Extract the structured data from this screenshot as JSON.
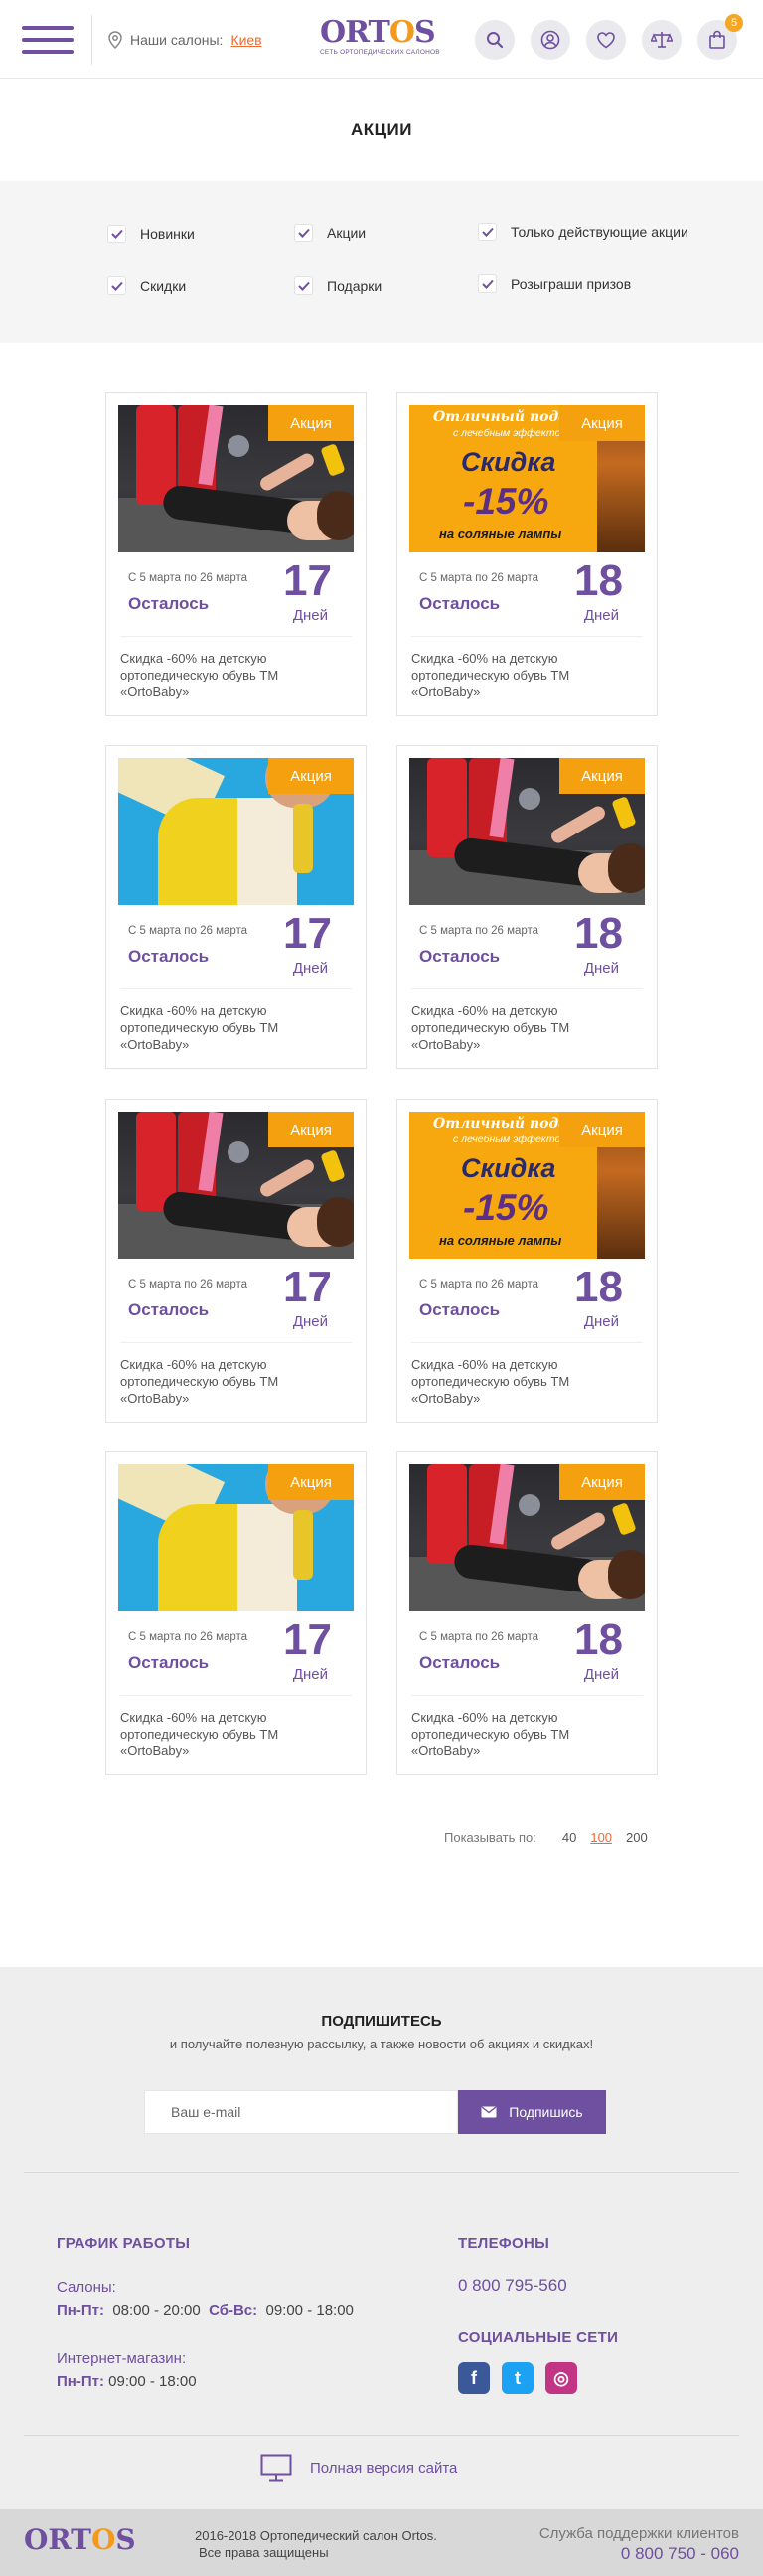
{
  "header": {
    "salons_label": "Наши салоны:",
    "city": "Киев",
    "logo_word_a": "ORT",
    "logo_word_b": "O",
    "logo_word_c": "S",
    "logo_sub": "СЕТЬ ОРТОПЕДИЧЕСКИХ САЛОНОВ",
    "cart_count": "5"
  },
  "page_title": "АКЦИИ",
  "filters": [
    {
      "label": "Новинки",
      "checked": true
    },
    {
      "label": "Акции",
      "checked": true
    },
    {
      "label": "Только действующие акции",
      "checked": true
    },
    {
      "label": "Скидки",
      "checked": true
    },
    {
      "label": "Подарки",
      "checked": true
    },
    {
      "label": "Розыграши призов",
      "checked": true
    }
  ],
  "sale_banner": {
    "line1": "Отличный подарок",
    "line2": "с лечебным эффектом",
    "line3": "Скидка",
    "line4": "-15%",
    "line5": "на соляные лампы"
  },
  "cards": [
    {
      "image": "yoga",
      "tag": "Акция",
      "dates": "С 5 марта по 26 марта",
      "left_label": "Осталось",
      "days_num": "17",
      "days_label": "Дней",
      "desc": "Скидка -60% на детскую ортопедическую обувь ТМ «OrtoBaby»"
    },
    {
      "image": "sale",
      "tag": "Акция",
      "dates": "С 5 марта по 26 марта",
      "left_label": "Осталось",
      "days_num": "18",
      "days_label": "Дней",
      "desc": "Скидка -60% на детскую ортопедическую обувь ТМ «OrtoBaby»"
    },
    {
      "image": "kid",
      "tag": "Акция",
      "dates": "С 5 марта по 26 марта",
      "left_label": "Осталось",
      "days_num": "17",
      "days_label": "Дней",
      "desc": "Скидка -60% на детскую ортопедическую обувь ТМ «OrtoBaby»"
    },
    {
      "image": "yoga",
      "tag": "Акция",
      "dates": "С 5 марта по 26 марта",
      "left_label": "Осталось",
      "days_num": "18",
      "days_label": "Дней",
      "desc": "Скидка -60% на детскую ортопедическую обувь ТМ «OrtoBaby»"
    },
    {
      "image": "yoga",
      "tag": "Акция",
      "dates": "С 5 марта по 26 марта",
      "left_label": "Осталось",
      "days_num": "17",
      "days_label": "Дней",
      "desc": "Скидка -60% на детскую ортопедическую обувь ТМ «OrtoBaby»"
    },
    {
      "image": "sale",
      "tag": "Акция",
      "dates": "С 5 марта по 26 марта",
      "left_label": "Осталось",
      "days_num": "18",
      "days_label": "Дней",
      "desc": "Скидка -60% на детскую ортопедическую обувь ТМ «OrtoBaby»"
    },
    {
      "image": "kid",
      "tag": "Акция",
      "dates": "С 5 марта по 26 марта",
      "left_label": "Осталось",
      "days_num": "17",
      "days_label": "Дней",
      "desc": "Скидка -60% на детскую ортопедическую обувь ТМ «OrtoBaby»"
    },
    {
      "image": "yoga",
      "tag": "Акция",
      "dates": "С 5 марта по 26 марта",
      "left_label": "Осталось",
      "days_num": "18",
      "days_label": "Дней",
      "desc": "Скидка -60% на детскую ортопедическую обувь ТМ «OrtoBaby»"
    }
  ],
  "pagination": {
    "label": "Показывать по:",
    "options": [
      "40",
      "100",
      "200"
    ],
    "active": "100"
  },
  "subscribe": {
    "title": "ПОДПИШИТЕСЬ",
    "text": "и получайте полезную рассылку, а также новости об акциях и скидках!",
    "placeholder": "Ваш e-mail",
    "button": "Подпишись"
  },
  "schedule": {
    "title": "ГРАФИК РАБОТЫ",
    "salons_label": "Салоны:",
    "weekdays_label": "Пн-Пт:",
    "weekdays_hours": "08:00 - 20:00",
    "weekend_label": "Сб-Вс:",
    "weekend_hours": "09:00 - 18:00",
    "shop_label": "Интернет-магазин:",
    "shop_days_label": "Пн-Пт:",
    "shop_hours": "09:00 - 18:00"
  },
  "phones": {
    "title": "ТЕЛЕФОНЫ",
    "number": "0 800 795-560"
  },
  "socials": {
    "title": "СОЦИАЛЬНЫЕ СЕТИ",
    "items": [
      {
        "name": "facebook-icon",
        "glyph": "f",
        "color": "#3b5998"
      },
      {
        "name": "twitter-icon",
        "glyph": "t",
        "color": "#1da1f2"
      },
      {
        "name": "instagram-icon",
        "glyph": "◎",
        "color": "#c13584"
      }
    ]
  },
  "full_version": "Полная версия сайта",
  "bottom": {
    "copyright_l1": "2016-2018  Ортопедический салон Ortos.",
    "copyright_l2": "Все права защищены",
    "support_label": "Служба поддержки клиентов",
    "support_phone": "0 800 750 - 060"
  },
  "colors": {
    "brand": "#6f4fa0",
    "accent": "#f5a00e",
    "link": "#ef6a32"
  }
}
